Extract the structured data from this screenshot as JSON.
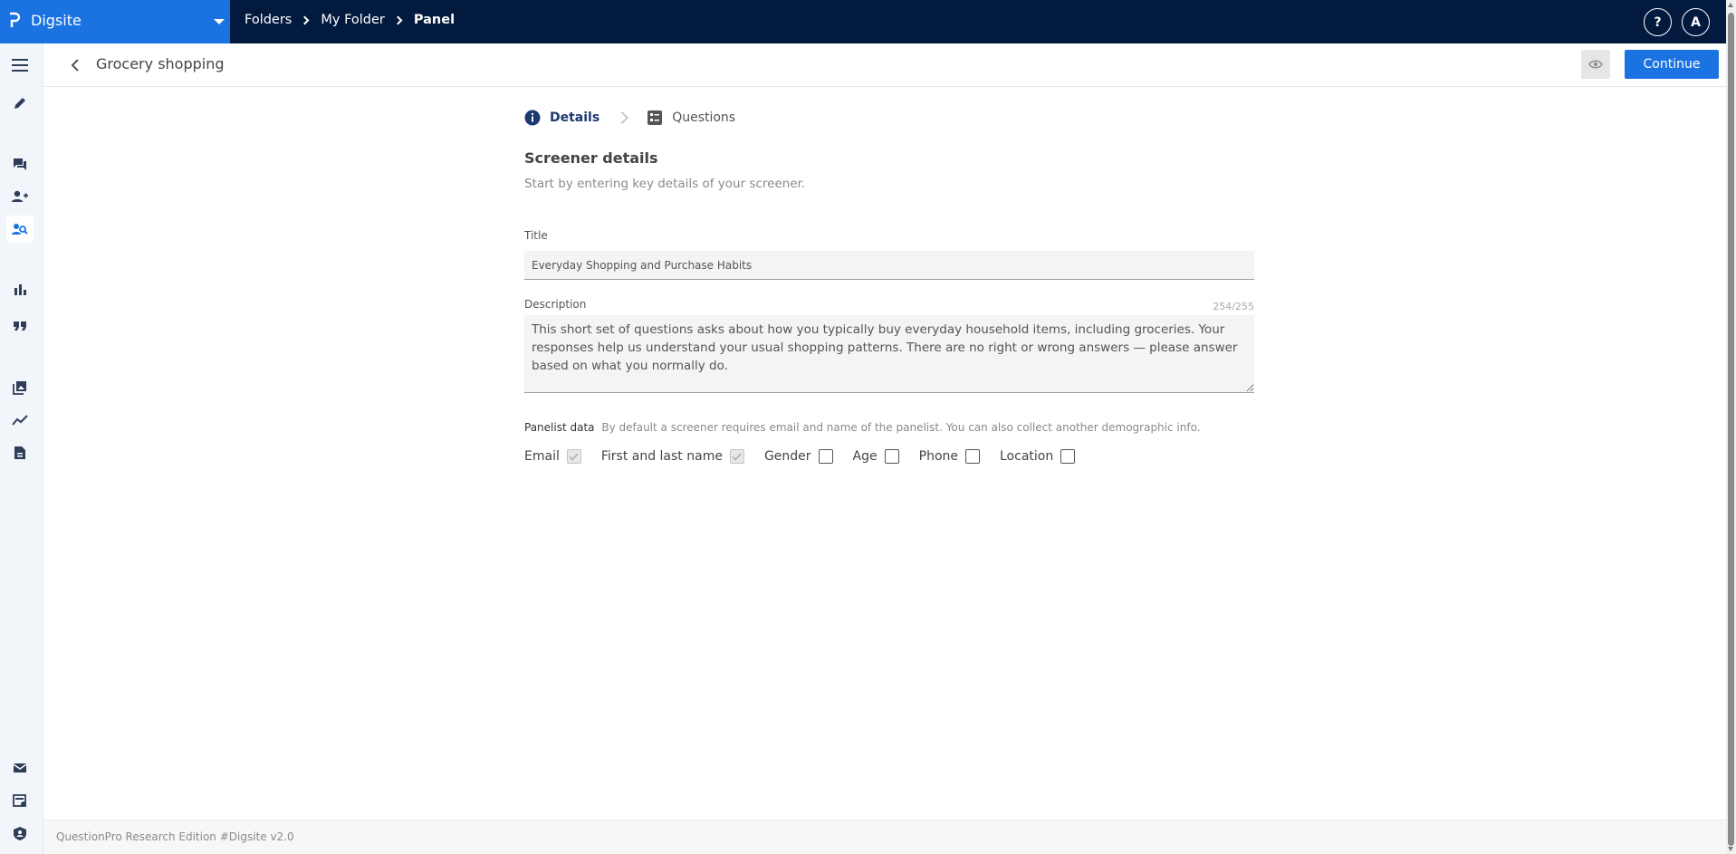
{
  "app": {
    "name": "Digsite",
    "brand_color": "#1a73e0",
    "topbar_color": "#031a3f"
  },
  "breadcrumb": {
    "items": [
      "Folders",
      "My Folder",
      "Panel"
    ]
  },
  "topbar_actions": {
    "help_label": "?",
    "avatar_initial": "A"
  },
  "left_nav": {
    "icons": [
      "menu-icon",
      "edit-icon",
      "chat-icon",
      "add-person-icon",
      "people-search-icon",
      "bar-chart-icon",
      "quote-icon",
      "image-library-icon",
      "trend-icon",
      "document-icon",
      "mail-icon",
      "billing-icon",
      "shield-user-icon"
    ],
    "active": "people-search-icon"
  },
  "header": {
    "title": "Grocery shopping",
    "continue_label": "Continue"
  },
  "stepper": {
    "steps": [
      {
        "label": "Details",
        "icon": "info-icon",
        "active": true
      },
      {
        "label": "Questions",
        "icon": "list-icon",
        "active": false
      }
    ]
  },
  "form": {
    "section_title": "Screener details",
    "section_subtitle": "Start by entering key details of your screener.",
    "title_label": "Title",
    "title_value": "Everyday Shopping and Purchase Habits",
    "description_label": "Description",
    "description_counter": "254/255",
    "description_value": "This short set of questions asks about how you typically buy everyday household items, including groceries. Your responses help us understand your usual shopping patterns. There are no right or wrong answers — please answer based on what you normally do.",
    "panelist_label": "Panelist data",
    "panelist_note": "By default a screener requires email and name of the panelist. You can also collect another demographic info.",
    "checkboxes": [
      {
        "label": "Email",
        "checked": true,
        "disabled": true
      },
      {
        "label": "First and last name",
        "checked": true,
        "disabled": true
      },
      {
        "label": "Gender",
        "checked": false,
        "disabled": false
      },
      {
        "label": "Age",
        "checked": false,
        "disabled": false
      },
      {
        "label": "Phone",
        "checked": false,
        "disabled": false
      },
      {
        "label": "Location",
        "checked": false,
        "disabled": false
      }
    ]
  },
  "footer": {
    "text": "QuestionPro Research Edition #Digsite v2.0"
  }
}
